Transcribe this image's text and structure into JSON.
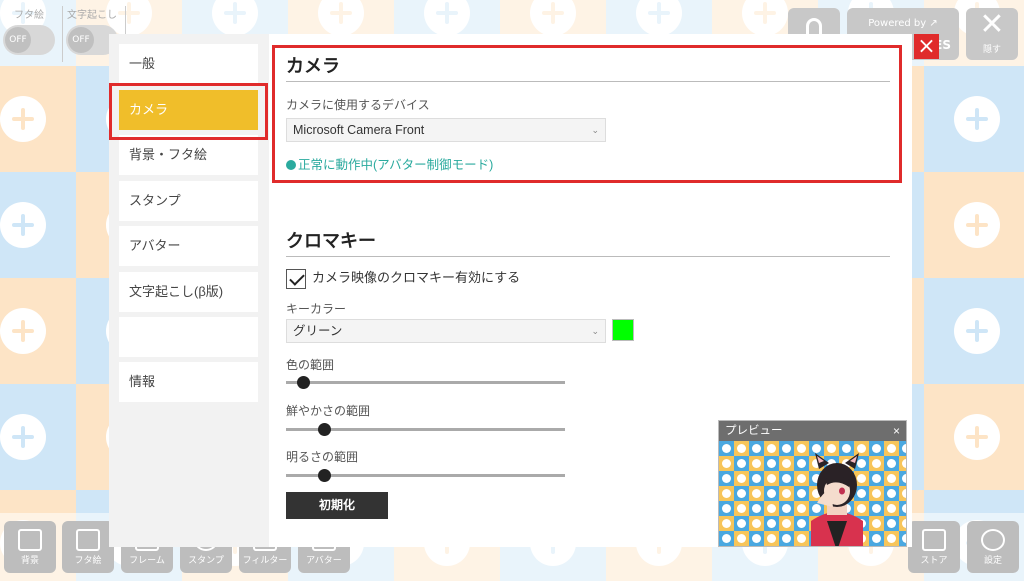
{
  "topbar": {
    "futae_toggle": {
      "label": "フタ絵",
      "state": "OFF"
    },
    "transcribe_toggle": {
      "label": "文字起こし",
      "state": "OFF"
    },
    "powered_by": "Powered by",
    "powered_brand_fragment": "ES",
    "hide_label": "隠す"
  },
  "bottombar": {
    "buttons": [
      "背景",
      "フタ絵",
      "フレーム",
      "スタンプ",
      "フィルター",
      "アバター",
      "ストア",
      "設定"
    ]
  },
  "sidebar": {
    "items": [
      {
        "label": "一般"
      },
      {
        "label": "カメラ",
        "active": true
      },
      {
        "label": "背景・フタ絵"
      },
      {
        "label": "スタンプ"
      },
      {
        "label": "アバター"
      },
      {
        "label": "文字起こし(β版)"
      },
      {
        "label": ""
      },
      {
        "label": "情報"
      }
    ]
  },
  "camera": {
    "title": "カメラ",
    "device_label": "カメラに使用するデバイス",
    "device_value": "Microsoft Camera Front",
    "status": "正常に動作中(アバター制御モード)"
  },
  "chromakey": {
    "title": "クロマキー",
    "enable_label": "カメラ映像のクロマキー有効にする",
    "enabled": true,
    "key_color_label": "キーカラー",
    "key_color_value": "グリーン",
    "key_color_hex": "#00ff00",
    "hue_range_label": "色の範囲",
    "hue_range_value": 0.04,
    "saturation_range_label": "鮮やかさの範囲",
    "saturation_range_value": 0.12,
    "brightness_range_label": "明るさの範囲",
    "brightness_range_value": 0.12,
    "reset_label": "初期化"
  },
  "preview": {
    "title": "プレビュー",
    "close": "×"
  },
  "modal_close": "×",
  "colors": {
    "accent_active": "#f0be2a",
    "highlight": "#e02b2b",
    "status": "#2aaa9e"
  }
}
